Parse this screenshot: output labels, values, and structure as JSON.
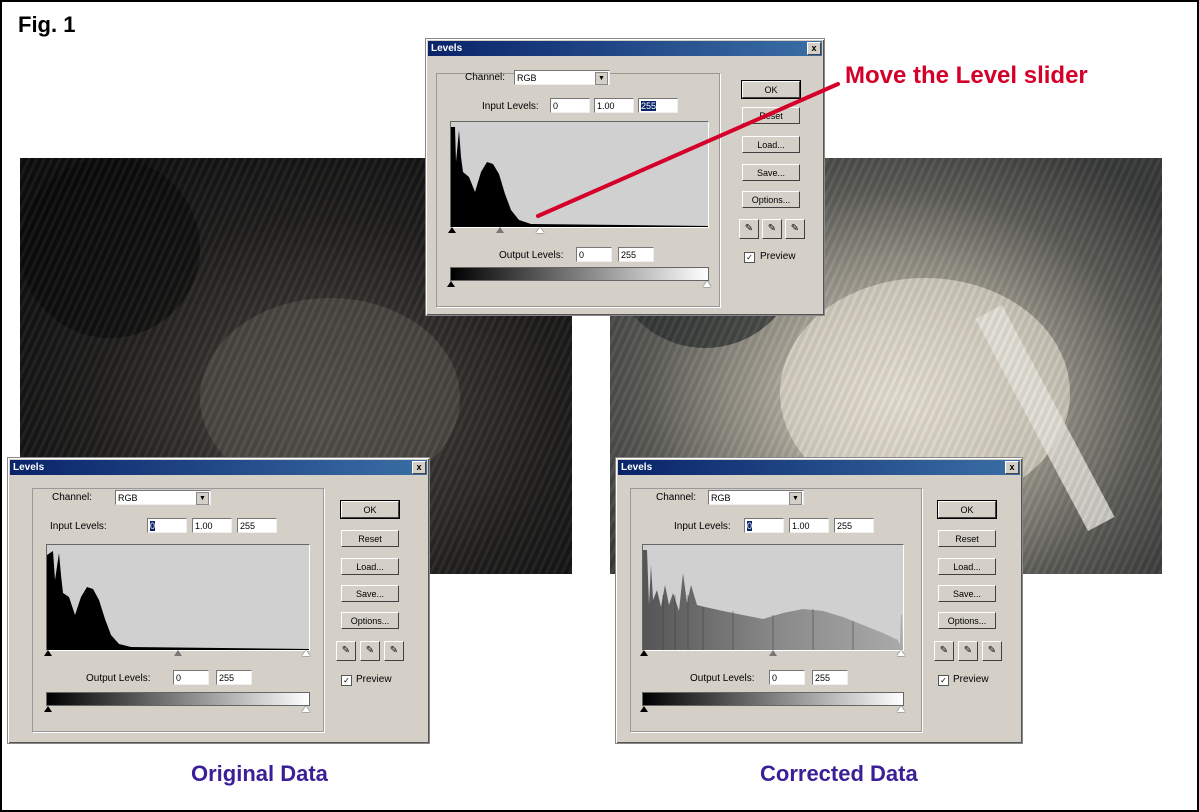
{
  "figure_label": "Fig. 1",
  "callout": "Move the Level slider",
  "captions": {
    "original": "Original Data",
    "corrected": "Corrected Data"
  },
  "dialog": {
    "title": "Levels",
    "close": "x",
    "channel_label": "Channel:",
    "channel_value": "RGB",
    "input_levels_label": "Input Levels:",
    "output_levels_label": "Output Levels:",
    "buttons": {
      "ok": "OK",
      "reset": "Reset",
      "load": "Load...",
      "save": "Save...",
      "options": "Options..."
    },
    "preview_label": "Preview",
    "preview_checked": true
  },
  "dialogs": {
    "top": {
      "input_black": "0",
      "input_gamma": "1.00",
      "input_white": "255",
      "output_black": "0",
      "output_white": "255"
    },
    "original": {
      "input_black": "0",
      "input_gamma": "1.00",
      "input_white": "255",
      "output_black": "0",
      "output_white": "255"
    },
    "corrected": {
      "input_black": "0",
      "input_gamma": "1.00",
      "input_white": "255",
      "output_black": "0",
      "output_white": "255"
    }
  },
  "colors": {
    "callout": "#d5002a",
    "caption": "#3a1f96",
    "titlebar": "#0a246a"
  }
}
